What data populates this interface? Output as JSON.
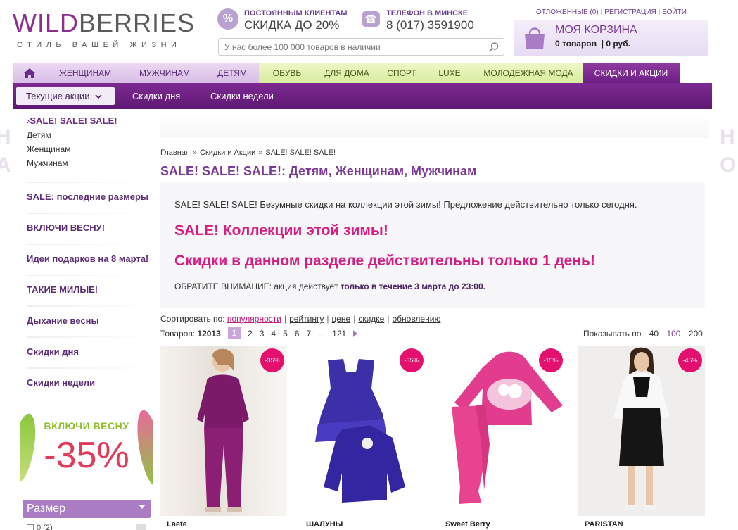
{
  "colors": {
    "brand": "#8b2f8e",
    "accent_pink": "#d51d83",
    "nav_active": "#7d2a92",
    "green_tab": "#e2f0ae"
  },
  "header": {
    "logo_part1": "WILD",
    "logo_part2": "BERRIES",
    "tagline": "СТИЛЬ ВАШЕЙ ЖИЗНИ",
    "promo_icon": "%",
    "promo_title": "ПОСТОЯННЫМ КЛИЕНТАМ",
    "promo_value": "СКИДКА ДО 20%",
    "phone_title": "ТЕЛЕФОН В МИНСКЕ",
    "phone_value": "8 (017) 3591900",
    "search_placeholder": "У нас более 100 000 товаров в наличии",
    "toplinks": [
      "ОТЛОЖЕННЫЕ (0)",
      "РЕГИСТРАЦИЯ",
      "ВОЙТИ"
    ],
    "cart_title": "МОЯ КОРЗИНА",
    "cart_items": "0 товаров",
    "cart_sum": "0 руб."
  },
  "nav": {
    "items": [
      {
        "label": "ЖЕНЩИНАМ"
      },
      {
        "label": "МУЖЧИНАМ"
      },
      {
        "label": "ДЕТЯМ"
      },
      {
        "label": "ОБУВЬ"
      },
      {
        "label": "ДЛЯ ДОМА"
      },
      {
        "label": "СПОРТ"
      },
      {
        "label": "LUXE"
      },
      {
        "label": "МОЛОДЕЖНАЯ МОДА"
      },
      {
        "label": "СКИДКИ И АКЦИИ"
      }
    ]
  },
  "subnav": {
    "current": "Текущие акции",
    "links": [
      "Скидки дня",
      "Скидки недели"
    ]
  },
  "sidebar": {
    "title": "SALE! SALE! SALE!",
    "subs": [
      "Детям",
      "Женщинам",
      "Мужчинам"
    ],
    "blocks": [
      "SALE: последние размеры",
      "ВКЛЮЧИ ВЕСНУ!",
      "Идеи подарков на 8 марта!",
      "ТАКИЕ МИЛЫЕ!",
      "Дыхание весны",
      "Скидки дня",
      "Скидки недели"
    ],
    "banner_title": "ВКЛЮЧИ ВЕСНУ",
    "banner_value": "-35%",
    "size_label": "Размер",
    "size_first_option": "0 (2)"
  },
  "content": {
    "breadcrumb": [
      "Главная",
      "Скидки и Акции",
      "SALE! SALE! SALE!"
    ],
    "title": "SALE! SALE! SALE!: Детям, Женщинам, Мужчинам",
    "promo_text": "SALE! SALE! SALE! Безумные скидки на коллекции этой зимы! Предложение действительно только сегодня.",
    "promo_big1": "SALE! Коллекции этой зимы!",
    "promo_big2": "Скидки в данном разделе действительны только 1 день!",
    "note_label": "ОБРАТИТЕ ВНИМАНИЕ:",
    "note_text": "акция действует",
    "note_bold": "только в течение 3 марта до 23:00.",
    "sort_label": "Сортировать по:",
    "sort_options": [
      "популярности",
      "рейтингу",
      "цене",
      "скидке",
      "обновлению"
    ],
    "count_label": "Товаров:",
    "count_value": "12013",
    "pages": [
      "1",
      "2",
      "3",
      "4",
      "5",
      "6",
      "7",
      "...",
      "121"
    ],
    "perpage_label": "Показывать по",
    "perpage_options": [
      "40",
      "100",
      "200"
    ]
  },
  "products": [
    {
      "brand": "Laete",
      "discount": "-35%"
    },
    {
      "brand": "ШАЛУНЫ",
      "discount": "-35%"
    },
    {
      "brand": "Sweet Berry",
      "discount": "-15%"
    },
    {
      "brand": "PARISTAN",
      "discount": "-45%"
    }
  ]
}
